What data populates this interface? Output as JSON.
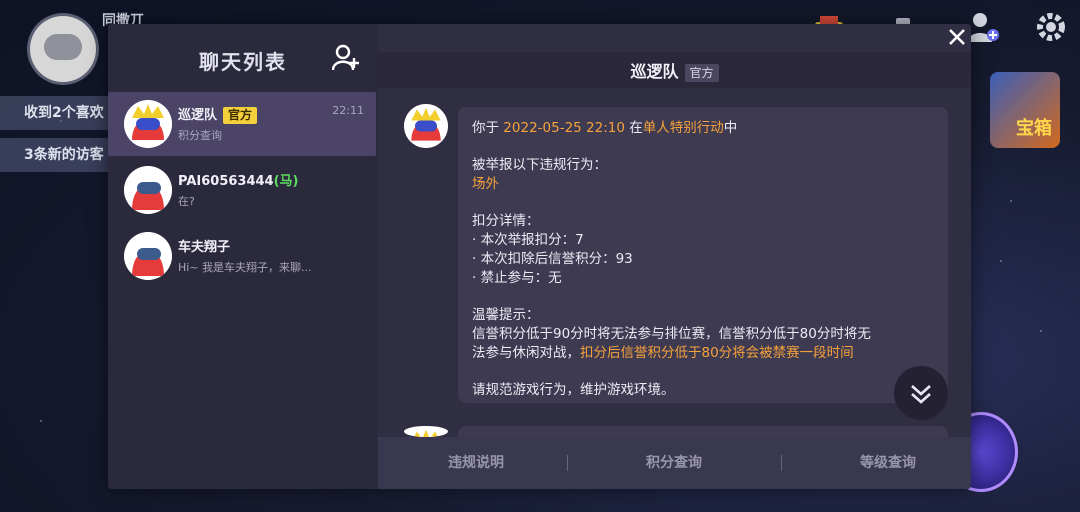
{
  "background": {
    "player_name": "同撒丌",
    "notifications": [
      "收到2个喜欢",
      "3条新的访客"
    ],
    "gift_label": "宝箱",
    "icons": [
      "shop-icon",
      "hat-icon",
      "add-friend-icon",
      "gear-icon"
    ]
  },
  "chat_list": {
    "title": "聊天列表",
    "add_icon": "add-friend-icon",
    "conversations": [
      {
        "name": "巡逻队",
        "badge": "官方",
        "preview": "积分查询",
        "time": "22:11",
        "active": true
      },
      {
        "name": "PAI60563444",
        "tag": "(马)",
        "preview": "在?",
        "time": "",
        "active": false
      },
      {
        "name": "车夫翔子",
        "preview": "Hi~ 我是车夫翔子，来聊...",
        "time": "",
        "active": false
      }
    ]
  },
  "chat": {
    "title": "巡逻队",
    "badge": "官方",
    "message": {
      "intro_prefix": "你于 ",
      "datetime": "2022-05-25 22:10",
      "intro_mid": " 在",
      "mode": "单人特别行动",
      "intro_suffix": "中",
      "reported": "被举报以下违规行为：",
      "violation": "场外",
      "details_title": "扣分详情：",
      "detail_1": "·  本次举报扣分：7",
      "detail_2": "·  本次扣除后信誉积分：93",
      "detail_3": "·  禁止参与：无",
      "tip_title": "温馨提示：",
      "tip_1": "信誉积分低于90分时将无法参与排位赛，信誉积分低于80分时将无",
      "tip_2_prefix": "法参与休闲对战，",
      "tip_2_highlight": "扣分后信誉积分低于80分将会被禁赛一段时间",
      "closing": "请规范游戏行为，维护游戏环境。"
    },
    "tabs": [
      "违规说明",
      "积分查询",
      "等级查询"
    ]
  },
  "colors": {
    "accent": "#f7a23a",
    "badge_yellow": "#f4d13a",
    "green_tag": "#5ddc60",
    "panel": "#2e2c40"
  }
}
